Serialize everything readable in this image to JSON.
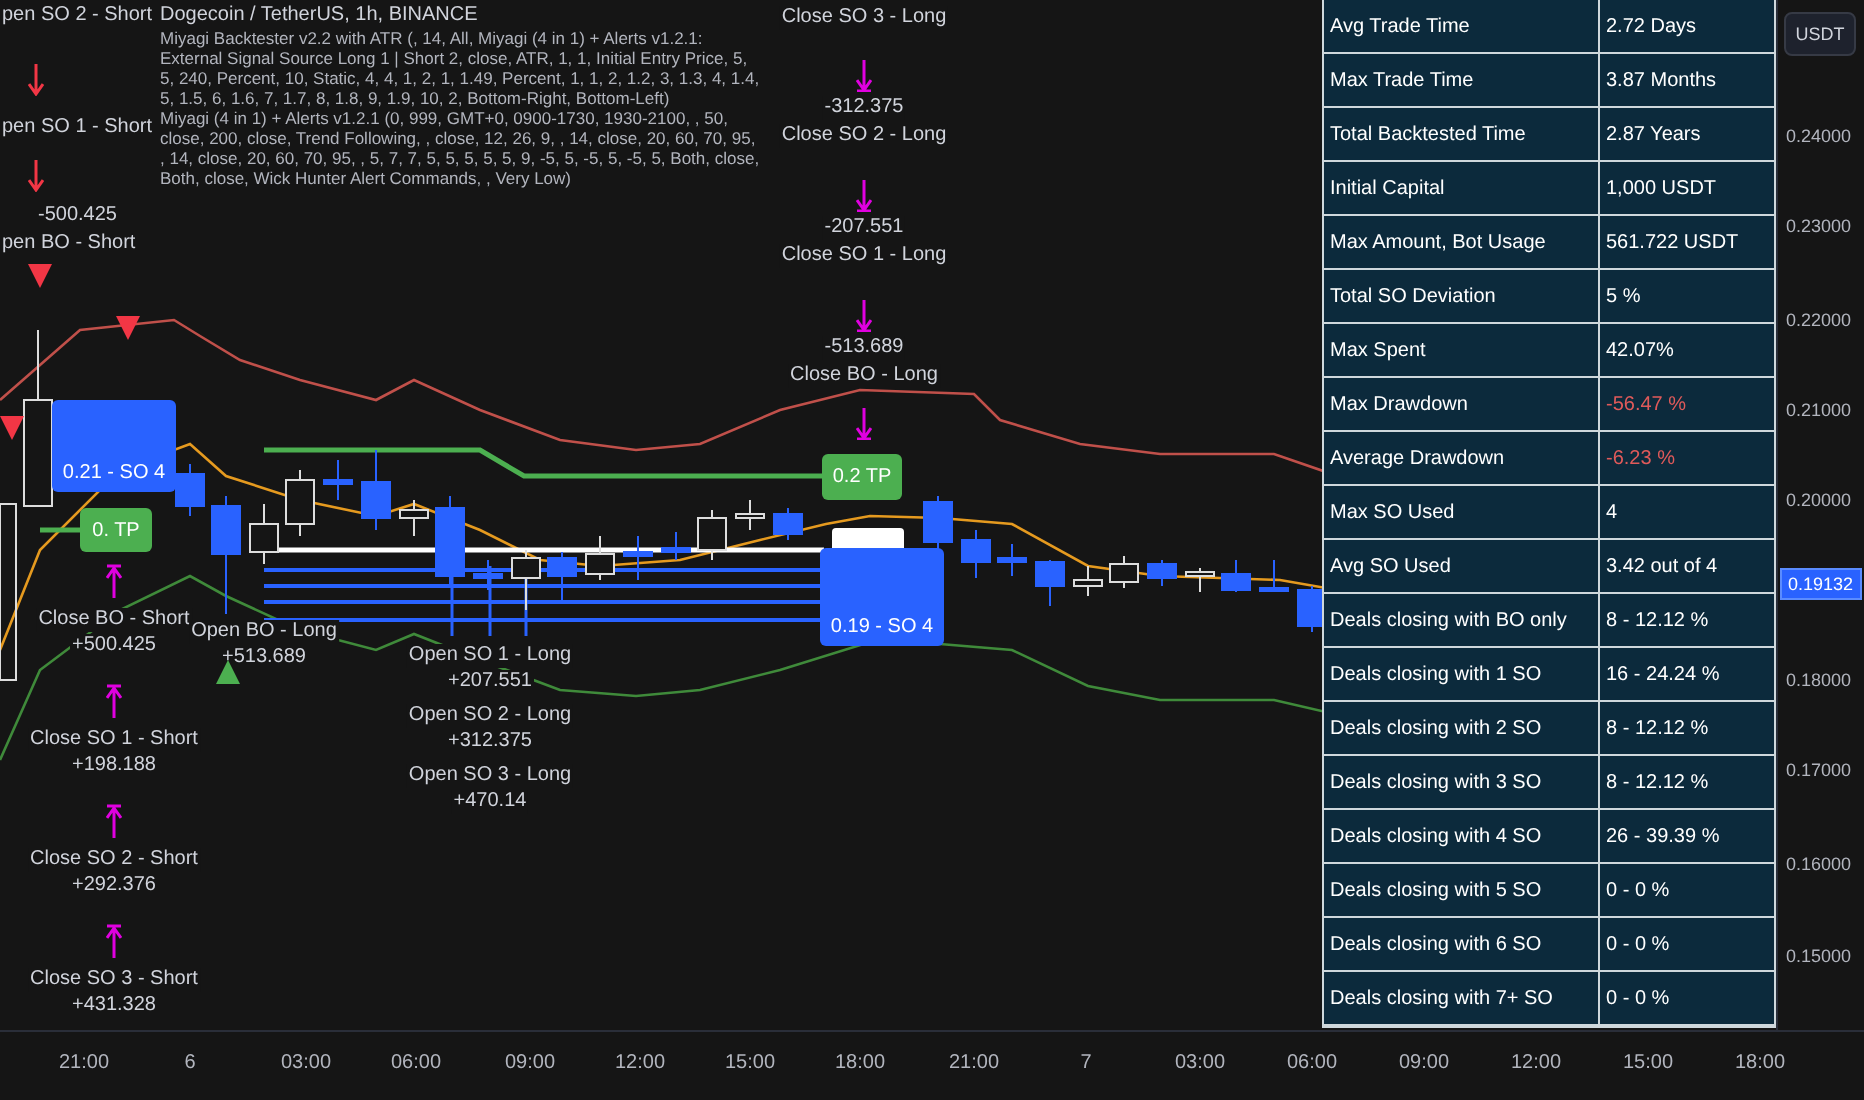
{
  "header": {
    "title": "Dogecoin / TetherUS, 1h, BINANCE",
    "indicators": [
      "Miyagi Backtester v2.2 with ATR (, 14, All, Miyagi (4 in 1) + Alerts v1.2.1: External Signal Source Long 1 | Short 2, close, ATR, 1, 1, Initial Entry Price, 5, 5, 240, Percent, 10, Static, 4, 4, 1, 2, 1, 1.49, Percent, 1, 1, 2, 1.2, 3, 1.3, 4, 1.4, 5, 1.5, 6, 1.6, 7, 1.7, 8, 1.8, 9, 1.9, 10, 2, Bottom-Right, Bottom-Left)",
      "Miyagi (4 in 1) + Alerts v1.2.1 (0, 999, GMT+0, 0900-1730, 1930-2100, , 50, close, 200, close, Trend Following, , close, 12, 26, 9, , 14, close, 20, 60, 70, 95, , 14, close, 20, 60, 70, 95, , 5, 7, 7, 5, 5, 5, 5, 5, 9, -5, 5, -5, 5, -5, 5, Both, close, Both, close, Wick Hunter Alert Commands, , Very Low)"
    ]
  },
  "short_open_labels": [
    "pen SO 2 - Short",
    "pen SO 1 - Short",
    "-500.425",
    "pen BO - Short"
  ],
  "long_close_labels": [
    "Close SO 3 - Long",
    "-312.375",
    "Close SO 2 - Long",
    "-207.551",
    "Close SO 1 - Long",
    "-513.689",
    "Close BO - Long"
  ],
  "short_close_labels": [
    {
      "label": "Close BO - Short",
      "value": "+500.425"
    },
    {
      "label": "Close SO 1 - Short",
      "value": "+198.188"
    },
    {
      "label": "Close SO 2 - Short",
      "value": "+292.376"
    },
    {
      "label": "Close SO 3 - Short",
      "value": "+431.328"
    }
  ],
  "long_open_labels": [
    {
      "label": "Open BO - Long",
      "value": "+513.689"
    },
    {
      "label": "Open SO 1 - Long",
      "value": "+207.551"
    },
    {
      "label": "Open SO 2 - Long",
      "value": "+312.375"
    },
    {
      "label": "Open SO 3 - Long",
      "value": "+470.14"
    }
  ],
  "order_tags": [
    {
      "kind": "safety-order",
      "text": "0.21 - SO 4"
    },
    {
      "kind": "take-profit",
      "text": "0. TP"
    },
    {
      "kind": "take-profit",
      "text": "0.2 TP"
    },
    {
      "kind": "safety-order",
      "text": "0.19 - SO 4"
    }
  ],
  "stats_table": [
    {
      "label": "Avg Trade Time",
      "value": "2.72 Days",
      "negative": false
    },
    {
      "label": "Max Trade Time",
      "value": "3.87 Months",
      "negative": false
    },
    {
      "label": "Total Backtested Time",
      "value": "2.87 Years",
      "negative": false
    },
    {
      "label": "Initial Capital",
      "value": "1,000 USDT",
      "negative": false
    },
    {
      "label": "Max Amount, Bot Usage",
      "value": "561.722 USDT",
      "negative": false
    },
    {
      "label": "Total SO Deviation",
      "value": "5 %",
      "negative": false
    },
    {
      "label": "Max Spent",
      "value": "42.07%",
      "negative": false
    },
    {
      "label": "Max Drawdown",
      "value": "-56.47 %",
      "negative": true
    },
    {
      "label": "Average Drawdown",
      "value": "-6.23 %",
      "negative": true
    },
    {
      "label": "Max SO Used",
      "value": "4",
      "negative": false
    },
    {
      "label": "Avg SO Used",
      "value": "3.42 out of 4",
      "negative": false
    },
    {
      "label": "Deals closing with BO only",
      "value": "8 - 12.12 %",
      "negative": false
    },
    {
      "label": "Deals closing with 1 SO",
      "value": "16 - 24.24 %",
      "negative": false
    },
    {
      "label": "Deals closing with 2 SO",
      "value": "8 - 12.12 %",
      "negative": false
    },
    {
      "label": "Deals closing with 3 SO",
      "value": "8 - 12.12 %",
      "negative": false
    },
    {
      "label": "Deals closing with 4 SO",
      "value": "26 - 39.39 %",
      "negative": false
    },
    {
      "label": "Deals closing with 5 SO",
      "value": "0 - 0 %",
      "negative": false
    },
    {
      "label": "Deals closing with 6 SO",
      "value": "0 - 0 %",
      "negative": false
    },
    {
      "label": "Deals closing with 7+ SO",
      "value": "0 - 0 %",
      "negative": false
    }
  ],
  "price_axis": {
    "unit_button": "USDT",
    "ticks": [
      "0.24000",
      "0.23000",
      "0.22000",
      "0.21000",
      "0.20000",
      "0.18000",
      "0.17000",
      "0.16000",
      "0.15000"
    ],
    "last_price": "0.19132"
  },
  "time_axis": [
    "21:00",
    "6",
    "03:00",
    "06:00",
    "09:00",
    "12:00",
    "15:00",
    "18:00",
    "21:00",
    "7",
    "03:00",
    "06:00",
    "09:00",
    "12:00",
    "15:00",
    "18:00"
  ]
}
